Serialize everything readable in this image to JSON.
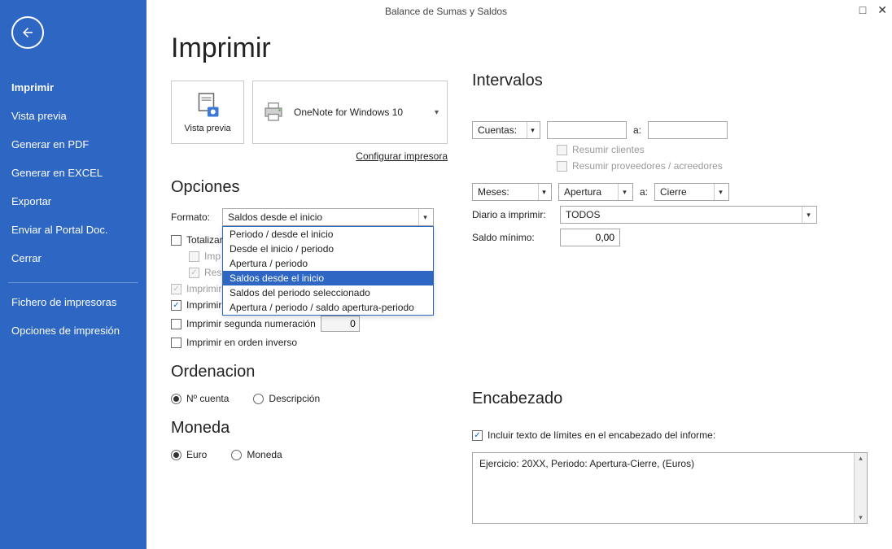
{
  "title": "Balance de Sumas y Saldos",
  "sidebar": {
    "items": [
      {
        "label": "Imprimir",
        "active": true
      },
      {
        "label": "Vista previa"
      },
      {
        "label": "Generar en PDF"
      },
      {
        "label": "Generar en EXCEL"
      },
      {
        "label": "Exportar"
      },
      {
        "label": "Enviar al Portal Doc."
      },
      {
        "label": "Cerrar"
      }
    ],
    "footer": [
      {
        "label": "Fichero de impresoras"
      },
      {
        "label": "Opciones de impresión"
      }
    ]
  },
  "page_heading": "Imprimir",
  "preview_label": "Vista previa",
  "printer_name": "OneNote for Windows 10",
  "configure_link": "Configurar impresora",
  "opciones": {
    "heading": "Opciones",
    "formato_label": "Formato:",
    "formato_value": "Saldos desde el inicio",
    "formato_options": [
      "Periodo / desde el inicio",
      "Desde el inicio / periodo",
      "Apertura / periodo",
      "Saldos desde el inicio",
      "Saldos del periodo seleccionado",
      "Apertura / periodo / saldo apertura-periodo"
    ],
    "totalizar": "Totalizar",
    "imp_truncated": "Imp",
    "res_truncated": "Res",
    "solo_titulos": "Imprimir solo títulos existentes",
    "cuentas_sin_saldo": "Imprimir cuentas sin saldo",
    "segunda_num": "Imprimir segunda numeración",
    "segunda_num_value": "0",
    "orden_inverso": "Imprimir en orden inverso"
  },
  "ordenacion": {
    "heading": "Ordenacion",
    "r1": "Nº cuenta",
    "r2": "Descripción"
  },
  "moneda": {
    "heading": "Moneda",
    "r1": "Euro",
    "r2": "Moneda"
  },
  "intervalos": {
    "heading": "Intervalos",
    "cuentas_label": "Cuentas:",
    "a_label": "a:",
    "resumir_clientes": "Resumir clientes",
    "resumir_prov": "Resumir proveedores / acreedores",
    "meses_label": "Meses:",
    "meses_from": "Apertura",
    "meses_to": "Cierre",
    "diario_label": "Diario a imprimir:",
    "diario_value": "TODOS",
    "saldo_min_label": "Saldo mínimo:",
    "saldo_min_value": "0,00"
  },
  "encabezado": {
    "heading": "Encabezado",
    "incluir": "Incluir texto de límites en el encabezado del informe:",
    "text": "Ejercicio: 20XX, Periodo: Apertura-Cierre, (Euros)"
  }
}
